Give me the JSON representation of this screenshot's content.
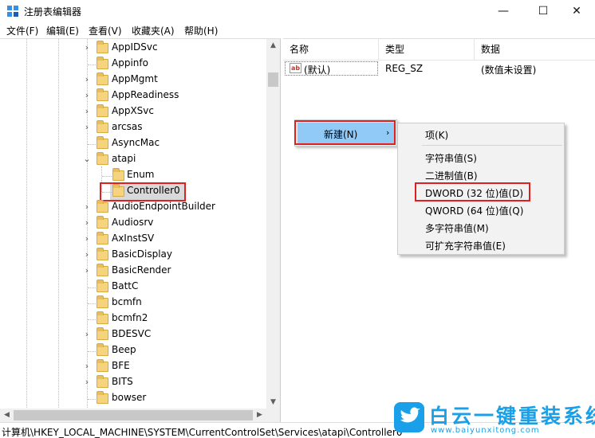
{
  "window": {
    "title": "注册表编辑器",
    "minimize_glyph": "—",
    "maximize_glyph": "☐",
    "close_glyph": "✕"
  },
  "menubar": {
    "items": [
      "文件(F)",
      "编辑(E)",
      "查看(V)",
      "收藏夹(A)",
      "帮助(H)"
    ]
  },
  "tree": {
    "expand_glyph": "›",
    "expanded_glyph": "⌄",
    "items": [
      {
        "label": "AppIDSvc",
        "level": 1,
        "expander": "collapsed"
      },
      {
        "label": "Appinfo",
        "level": 1,
        "expander": "none"
      },
      {
        "label": "AppMgmt",
        "level": 1,
        "expander": "collapsed"
      },
      {
        "label": "AppReadiness",
        "level": 1,
        "expander": "collapsed"
      },
      {
        "label": "AppXSvc",
        "level": 1,
        "expander": "collapsed"
      },
      {
        "label": "arcsas",
        "level": 1,
        "expander": "collapsed"
      },
      {
        "label": "AsyncMac",
        "level": 1,
        "expander": "none"
      },
      {
        "label": "atapi",
        "level": 1,
        "expander": "expanded"
      },
      {
        "label": "Enum",
        "level": 2,
        "expander": "none"
      },
      {
        "label": "Controller0",
        "level": 2,
        "expander": "none",
        "selected": true
      },
      {
        "label": "AudioEndpointBuilder",
        "level": 1,
        "expander": "collapsed"
      },
      {
        "label": "Audiosrv",
        "level": 1,
        "expander": "collapsed"
      },
      {
        "label": "AxInstSV",
        "level": 1,
        "expander": "collapsed"
      },
      {
        "label": "BasicDisplay",
        "level": 1,
        "expander": "collapsed"
      },
      {
        "label": "BasicRender",
        "level": 1,
        "expander": "collapsed"
      },
      {
        "label": "BattC",
        "level": 1,
        "expander": "none"
      },
      {
        "label": "bcmfn",
        "level": 1,
        "expander": "none"
      },
      {
        "label": "bcmfn2",
        "level": 1,
        "expander": "none"
      },
      {
        "label": "BDESVC",
        "level": 1,
        "expander": "collapsed"
      },
      {
        "label": "Beep",
        "level": 1,
        "expander": "none"
      },
      {
        "label": "BFE",
        "level": 1,
        "expander": "collapsed"
      },
      {
        "label": "BITS",
        "level": 1,
        "expander": "collapsed"
      },
      {
        "label": "bowser",
        "level": 1,
        "expander": "none"
      }
    ]
  },
  "list": {
    "columns": [
      "名称",
      "类型",
      "数据"
    ],
    "rows": [
      {
        "icon": "string-value-icon",
        "icon_text": "ab",
        "name": "(默认)",
        "type": "REG_SZ",
        "data": "(数值未设置)"
      }
    ]
  },
  "context_menu": {
    "item_label": "新建(N)",
    "arrow": "›",
    "highlight_color": "#91c9f7"
  },
  "submenu": {
    "items": [
      "项(K)",
      "字符串值(S)",
      "二进制值(B)",
      "DWORD (32 位)值(D)",
      "QWORD (64 位)值(Q)",
      "多字符串值(M)",
      "可扩充字符串值(E)"
    ]
  },
  "status": {
    "path": "计算机\\HKEY_LOCAL_MACHINE\\SYSTEM\\CurrentControlSet\\Services\\atapi\\Controller0"
  },
  "watermark": {
    "title": "白云一键重装系统",
    "url": "www.baiyunxitong.com",
    "color": "#1aa0e8"
  },
  "colors": {
    "annotation_red": "#e02020",
    "folder_yellow": "#f6d37d"
  }
}
